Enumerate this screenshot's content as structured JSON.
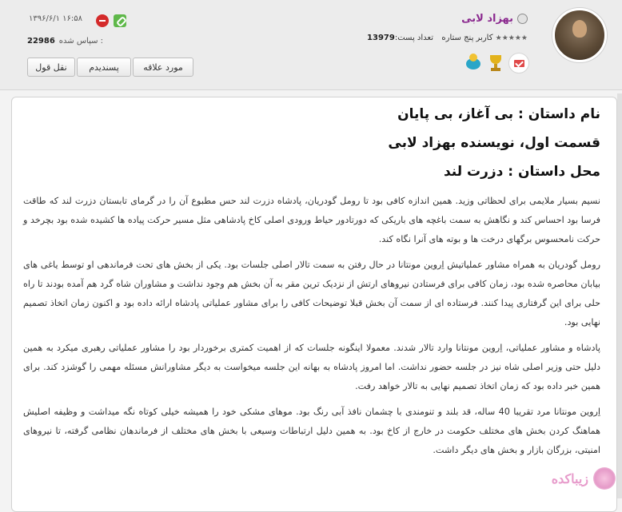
{
  "header": {
    "username": "بهزاد لابی",
    "rank_title": "کاربر پنج ستاره",
    "rank_stars": "★★★★★",
    "post_count_label": "تعداد پست:",
    "post_count_value": "13979",
    "post_datetime": "۱۳۹۶/۶/۱   ۱۶:۵۸",
    "thanks_label": "سپاس شده :",
    "thanks_value": "22986"
  },
  "buttons": {
    "quote": "نقل قول",
    "like": "پسندیدم",
    "favorite": "مورد علاقه"
  },
  "post": {
    "headings": [
      "نام داستان : بی آغاز، بی پایان",
      "قسمت اول، نویسنده بهزاد لابی",
      "محل داستان : دزرت لند"
    ],
    "paragraphs": [
      "نسیم بسیار ملایمی برای لحظاتی وزید. همین اندازه کافی بود تا رومل گودریان، پادشاه دزرت لند حس مطبوع آن را در گرمای تابستان دزرت لند که طاقت فرسا بود احساس کند و نگاهش به سمت باغچه های باریکی که دورتادور حیاط ورودی اصلی کاخ پادشاهی مثل مسیر حرکت پیاده ها کشیده شده بود بچرخد و حرکت نامحسوس برگهای درخت ها و بوته های آنرا نگاه کند.",
      "رومل گودریان به همراه مشاور عملیاتیش اِروین مونتانا در حال رفتن به سمت تالار اصلی جلسات بود. یکی از بخش های تحت فرماندهی او توسط یاغی های بیابان محاصره شده بود، زمان کافی برای فرستادن نیروهای ارتش از نزدیک ترین مقر به آن بخش هم وجود نداشت و مشاوران شاه گرد هم آمده بودند تا راه حلی برای این گرفتاری پیدا کنند. فرستاده ای از سمت آن بخش قبلا توضیحات کافی را برای مشاور عملیاتی پادشاه ارائه داده بود و اکنون زمان اتخاذ تصمیم نهایی بود.",
      "پادشاه و مشاور عملیاتی، اِروین مونتانا وارد تالار شدند. معمولا اینگونه جلسات که از اهمیت کمتری برخوردار بود را مشاور عملیاتی رهبری میکرد به همین دلیل حتی وزیر اصلی شاه نیز در جلسه حضور نداشت. اما امروز پادشاه به بهانه این جلسه میخواست به دیگر مشاورانش مسئله مهمی را گوشزد کند. برای همین خبر داده بود که زمان اتخاذ تصمیم نهایی به تالار خواهد رفت.",
      "اِروین مونتانا مرد تقریبا 40 ساله، قد بلند و تنومندی با چشمان نافذ آبی رنگ بود. موهای مشکی خود را همیشه خیلی کوتاه نگه میداشت و وظیفه اصلیش هماهنگ کردن بخش های مختلف حکومت در خارج از کاخ بود. به همین دلیل ارتباطات وسیعی با بخش های مختلف از فرماندهان نظامی گرفته، تا نیروهای امنیتی، بزرگان بازار و بخش های دیگر داشت."
    ]
  },
  "watermark": {
    "text": "زیباکده"
  },
  "colors": {
    "username": "#8b2a8f",
    "header_bg": "#ececec",
    "content_bg": "#ffffff"
  }
}
